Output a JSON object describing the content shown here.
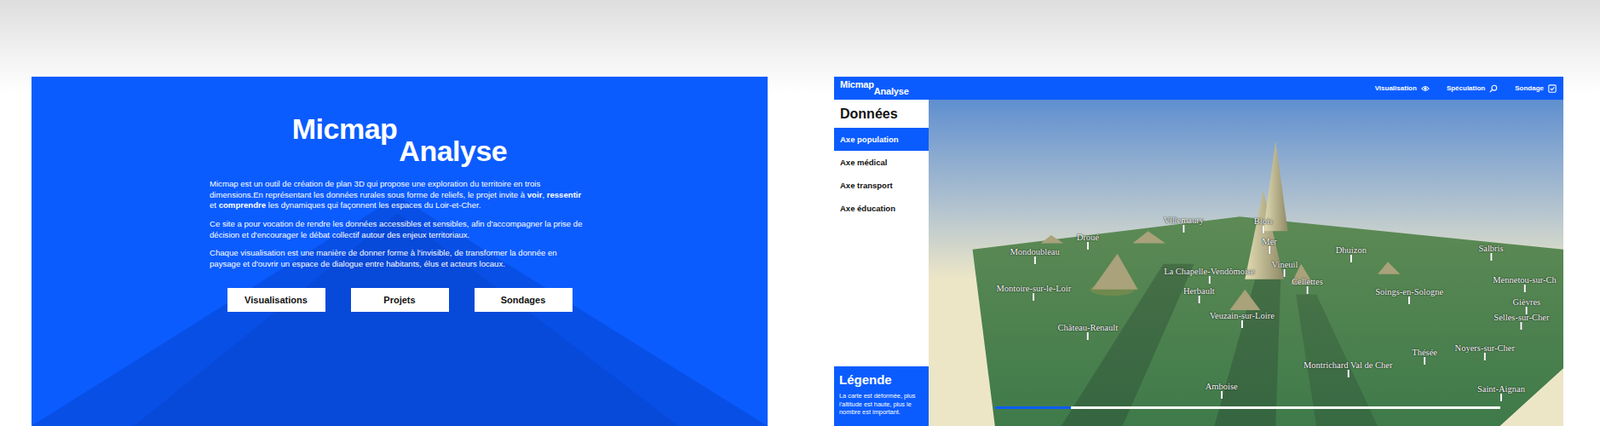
{
  "intro": {
    "logo": {
      "main": "Micmap",
      "sub": "Analyse"
    },
    "paragraphs": [
      [
        {
          "text": "Micmap est un outil de création de plan 3D qui propose une exploration du territoire en trois dimensions.En représentant les données rurales sous forme de reliefs, le projet invite à ",
          "bold": false
        },
        {
          "text": "voir",
          "bold": true
        },
        {
          "text": ", ",
          "bold": false
        },
        {
          "text": "ressentir",
          "bold": true
        },
        {
          "text": " et ",
          "bold": false
        },
        {
          "text": "comprendre",
          "bold": true
        },
        {
          "text": " les dynamiques qui façonnent les espaces du Loir-et-Cher.",
          "bold": false
        }
      ],
      [
        {
          "text": "Ce site a pour vocation de rendre les données accessibles et sensibles, afin d'accompagner la prise de décision et d'encourager le débat collectif autour des enjeux territoriaux.",
          "bold": false
        }
      ],
      [
        {
          "text": "Chaque visualisation est une manière de donner forme à l'invisible, de transformer la donnée en paysage et d'ouvrir un espace de dialogue entre habitants, élus et acteurs locaux.",
          "bold": false
        }
      ]
    ],
    "buttons": [
      "Visualisations",
      "Projets",
      "Sondages"
    ]
  },
  "app": {
    "logo": {
      "main": "Micmap",
      "sub": "Analyse"
    },
    "nav": [
      "Visualisation",
      "Spéculation",
      "Sondage"
    ],
    "sidebar": {
      "title": "Données",
      "items": [
        {
          "label": "Axe population",
          "selected": true
        },
        {
          "label": "Axe médical",
          "selected": false
        },
        {
          "label": "Axe transport",
          "selected": false
        },
        {
          "label": "Axe éducation",
          "selected": false
        }
      ]
    },
    "legend": {
      "title": "Légende",
      "text": "La carte est déformée, plus l'altitude est haute, plus le nombre est important."
    },
    "map": {
      "places": [
        "Villemaury",
        "Blois",
        "Droué",
        "Mer",
        "Mondoubleau",
        "Dhuizon",
        "Salbris",
        "Vineuil",
        "La Chapelle-Vendômoise",
        "Cellettes",
        "Mennetou-sur-Ch",
        "Montoire-sur-le-Loir",
        "Herbault",
        "Soings-en-Sologne",
        "Gièvres",
        "Veuzain-sur-Loire",
        "Selles-sur-Cher",
        "Château-Renault",
        "Thésée",
        "Noyers-sur-Cher",
        "Montrichard Val de Cher",
        "Saint-Aignan",
        "Amboise"
      ],
      "timeline": {
        "level": 0.15
      }
    }
  }
}
